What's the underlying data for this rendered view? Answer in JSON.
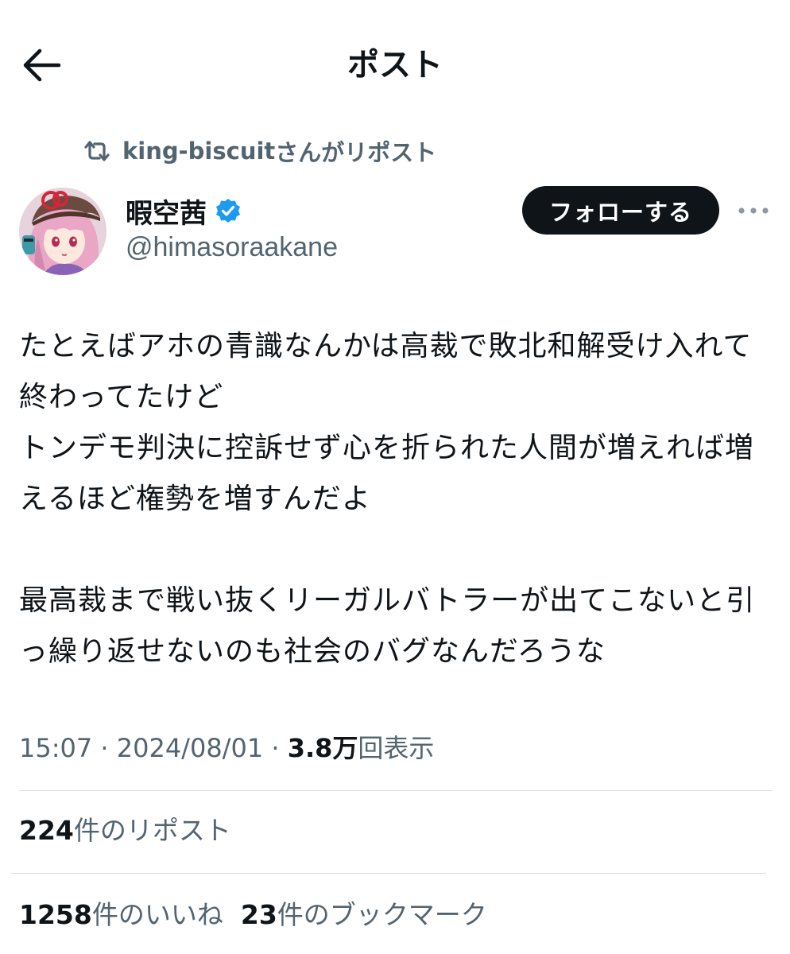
{
  "header": {
    "title": "ポスト",
    "back_icon": "arrow-left-icon"
  },
  "repost_context": {
    "icon": "repost-icon",
    "user": "king-biscuit",
    "suffix": " さんがリポスト"
  },
  "author": {
    "display_name": "暇空茜",
    "handle": "@himasoraakane",
    "verified": true,
    "verified_color": "#1d9bf0"
  },
  "follow_button": {
    "label": "フォローする"
  },
  "more_icon": "more-horizontal-icon",
  "tweet": {
    "text": "たとえばアホの青識なんかは高裁で敗北和解受け入れて終わってたけど\nトンデモ判決に控訴せず心を折られた人間が増えれば増えるほど権勢を増すんだよ\n\n最高裁まで戦い抜くリーガルバトラーが出てこないと引っ繰り返せないのも社会のバグなんだろうな"
  },
  "meta": {
    "time": "15:07",
    "separator": " · ",
    "date": "2024/08/01",
    "views_count": "3.8万",
    "views_label": "回表示"
  },
  "stats": {
    "reposts": {
      "count": "224",
      "label": "件のリポスト"
    },
    "likes": {
      "count": "1258",
      "label": "件のいいね"
    },
    "bookmarks": {
      "count": "23",
      "label": "件のブックマーク"
    }
  },
  "colors": {
    "text": "#0f1419",
    "secondary": "#536471",
    "divider": "#d9dee2",
    "button_bg": "#0f1419"
  }
}
